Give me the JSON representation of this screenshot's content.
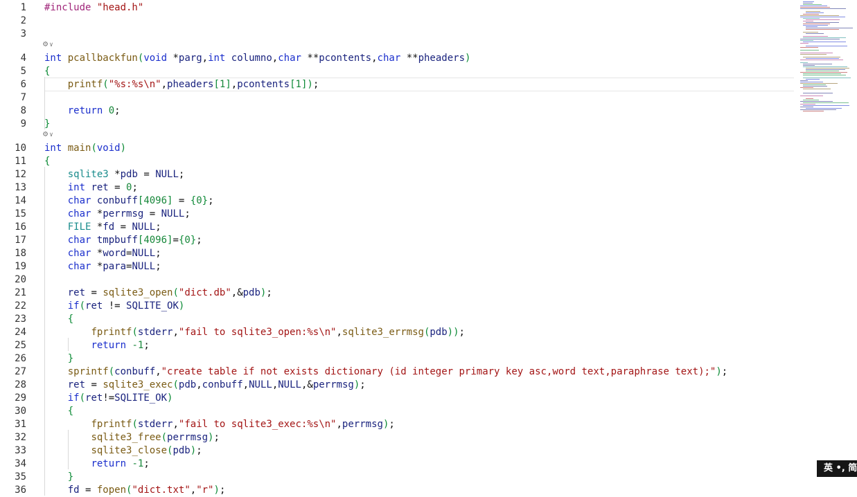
{
  "editor": {
    "current_line": 6,
    "lines": [
      {
        "n": "1",
        "t": [
          [
            "pp",
            "#include "
          ],
          [
            "str",
            "\"head.h\""
          ]
        ]
      },
      {
        "n": "2",
        "t": []
      },
      {
        "n": "3",
        "t": []
      },
      {
        "n": "4",
        "fold": true,
        "t": [
          [
            "kw",
            "int "
          ],
          [
            "fn",
            "pcallbackfun"
          ],
          [
            "br",
            "("
          ],
          [
            "kw",
            "void "
          ],
          [
            "",
            "*"
          ],
          [
            "var",
            "parg"
          ],
          [
            "",
            ","
          ],
          [
            "kw",
            "int "
          ],
          [
            "var",
            "columno"
          ],
          [
            "",
            ","
          ],
          [
            "kw",
            "char "
          ],
          [
            "",
            "**"
          ],
          [
            "var",
            "pcontents"
          ],
          [
            "",
            ","
          ],
          [
            "kw",
            "char "
          ],
          [
            "",
            "**"
          ],
          [
            "var",
            "pheaders"
          ],
          [
            "br",
            ")"
          ]
        ]
      },
      {
        "n": "5",
        "t": [
          [
            "br",
            "{"
          ]
        ]
      },
      {
        "n": "6",
        "t": [
          [
            "",
            "    "
          ],
          [
            "fn",
            "printf"
          ],
          [
            "br",
            "("
          ],
          [
            "str",
            "\"%s:%s\\n\""
          ],
          [
            "",
            ","
          ],
          [
            "var",
            "pheaders"
          ],
          [
            "br",
            "["
          ],
          [
            "num",
            "1"
          ],
          [
            "br",
            "]"
          ],
          [
            "",
            ","
          ],
          [
            "var",
            "pcontents"
          ],
          [
            "br",
            "["
          ],
          [
            "num",
            "1"
          ],
          [
            "br",
            "])"
          ],
          [
            "",
            ";"
          ]
        ]
      },
      {
        "n": "7",
        "t": []
      },
      {
        "n": "8",
        "t": [
          [
            "",
            "    "
          ],
          [
            "kw",
            "return "
          ],
          [
            "num",
            "0"
          ],
          [
            "",
            ";"
          ]
        ]
      },
      {
        "n": "9",
        "t": [
          [
            "br",
            "}"
          ]
        ]
      },
      {
        "n": "10",
        "fold": true,
        "t": [
          [
            "kw",
            "int "
          ],
          [
            "fn",
            "main"
          ],
          [
            "br",
            "("
          ],
          [
            "kw",
            "void"
          ],
          [
            "br",
            ")"
          ]
        ]
      },
      {
        "n": "11",
        "t": [
          [
            "br",
            "{"
          ]
        ]
      },
      {
        "n": "12",
        "t": [
          [
            "",
            "    "
          ],
          [
            "ty",
            "sqlite3 "
          ],
          [
            "",
            "*"
          ],
          [
            "var",
            "pdb"
          ],
          [
            "",
            " = "
          ],
          [
            "mac",
            "NULL"
          ],
          [
            "",
            ";"
          ]
        ]
      },
      {
        "n": "13",
        "t": [
          [
            "",
            "    "
          ],
          [
            "kw",
            "int "
          ],
          [
            "var",
            "ret"
          ],
          [
            "",
            " = "
          ],
          [
            "num",
            "0"
          ],
          [
            "",
            ";"
          ]
        ]
      },
      {
        "n": "14",
        "t": [
          [
            "",
            "    "
          ],
          [
            "kw",
            "char "
          ],
          [
            "var",
            "conbuff"
          ],
          [
            "br",
            "["
          ],
          [
            "num",
            "4096"
          ],
          [
            "br",
            "]"
          ],
          [
            "",
            " = "
          ],
          [
            "br",
            "{"
          ],
          [
            "num",
            "0"
          ],
          [
            "br",
            "}"
          ],
          [
            "",
            ";"
          ]
        ]
      },
      {
        "n": "15",
        "t": [
          [
            "",
            "    "
          ],
          [
            "kw",
            "char "
          ],
          [
            "",
            "*"
          ],
          [
            "var",
            "perrmsg"
          ],
          [
            "",
            " = "
          ],
          [
            "mac",
            "NULL"
          ],
          [
            "",
            ";"
          ]
        ]
      },
      {
        "n": "16",
        "t": [
          [
            "",
            "    "
          ],
          [
            "ty",
            "FILE "
          ],
          [
            "",
            "*"
          ],
          [
            "var",
            "fd"
          ],
          [
            "",
            " = "
          ],
          [
            "mac",
            "NULL"
          ],
          [
            "",
            ";"
          ]
        ]
      },
      {
        "n": "17",
        "t": [
          [
            "",
            "    "
          ],
          [
            "kw",
            "char "
          ],
          [
            "var",
            "tmpbuff"
          ],
          [
            "br",
            "["
          ],
          [
            "num",
            "4096"
          ],
          [
            "br",
            "]"
          ],
          [
            "",
            "="
          ],
          [
            "br",
            "{"
          ],
          [
            "num",
            "0"
          ],
          [
            "br",
            "}"
          ],
          [
            "",
            ";"
          ]
        ]
      },
      {
        "n": "18",
        "t": [
          [
            "",
            "    "
          ],
          [
            "kw",
            "char "
          ],
          [
            "",
            "*"
          ],
          [
            "var",
            "word"
          ],
          [
            "",
            "="
          ],
          [
            "mac",
            "NULL"
          ],
          [
            "",
            ";"
          ]
        ]
      },
      {
        "n": "19",
        "t": [
          [
            "",
            "    "
          ],
          [
            "kw",
            "char "
          ],
          [
            "",
            "*"
          ],
          [
            "var",
            "para"
          ],
          [
            "",
            "="
          ],
          [
            "mac",
            "NULL"
          ],
          [
            "",
            ";"
          ]
        ]
      },
      {
        "n": "20",
        "t": []
      },
      {
        "n": "21",
        "t": [
          [
            "",
            "    "
          ],
          [
            "var",
            "ret"
          ],
          [
            "",
            " = "
          ],
          [
            "fn",
            "sqlite3_open"
          ],
          [
            "br",
            "("
          ],
          [
            "str",
            "\"dict.db\""
          ],
          [
            "",
            ",&"
          ],
          [
            "var",
            "pdb"
          ],
          [
            "br",
            ")"
          ],
          [
            "",
            ";"
          ]
        ]
      },
      {
        "n": "22",
        "t": [
          [
            "",
            "    "
          ],
          [
            "kw",
            "if"
          ],
          [
            "br",
            "("
          ],
          [
            "var",
            "ret"
          ],
          [
            "",
            " != "
          ],
          [
            "mac",
            "SQLITE_OK"
          ],
          [
            "br",
            ")"
          ]
        ]
      },
      {
        "n": "23",
        "t": [
          [
            "",
            "    "
          ],
          [
            "br",
            "{"
          ]
        ]
      },
      {
        "n": "24",
        "t": [
          [
            "",
            "        "
          ],
          [
            "fn",
            "fprintf"
          ],
          [
            "br",
            "("
          ],
          [
            "var",
            "stderr"
          ],
          [
            "",
            ","
          ],
          [
            "str",
            "\"fail to sqlite3_open:%s\\n\""
          ],
          [
            "",
            ","
          ],
          [
            "fn",
            "sqlite3_errmsg"
          ],
          [
            "br",
            "("
          ],
          [
            "var",
            "pdb"
          ],
          [
            "br",
            "))"
          ],
          [
            "",
            ";"
          ]
        ]
      },
      {
        "n": "25",
        "t": [
          [
            "",
            "        "
          ],
          [
            "kw",
            "return "
          ],
          [
            "num",
            "-1"
          ],
          [
            "",
            ";"
          ]
        ]
      },
      {
        "n": "26",
        "t": [
          [
            "",
            "    "
          ],
          [
            "br",
            "}"
          ]
        ]
      },
      {
        "n": "27",
        "t": [
          [
            "",
            "    "
          ],
          [
            "fn",
            "sprintf"
          ],
          [
            "br",
            "("
          ],
          [
            "var",
            "conbuff"
          ],
          [
            "",
            ","
          ],
          [
            "str",
            "\"create table if not exists dictionary (id integer primary key asc,word text,paraphrase text);\""
          ],
          [
            "br",
            ")"
          ],
          [
            "",
            ";"
          ]
        ]
      },
      {
        "n": "28",
        "t": [
          [
            "",
            "    "
          ],
          [
            "var",
            "ret"
          ],
          [
            "",
            " = "
          ],
          [
            "fn",
            "sqlite3_exec"
          ],
          [
            "br",
            "("
          ],
          [
            "var",
            "pdb"
          ],
          [
            "",
            ","
          ],
          [
            "var",
            "conbuff"
          ],
          [
            "",
            ","
          ],
          [
            "mac",
            "NULL"
          ],
          [
            "",
            ","
          ],
          [
            "mac",
            "NULL"
          ],
          [
            "",
            ",&"
          ],
          [
            "var",
            "perrmsg"
          ],
          [
            "br",
            ")"
          ],
          [
            "",
            ";"
          ]
        ]
      },
      {
        "n": "29",
        "t": [
          [
            "",
            "    "
          ],
          [
            "kw",
            "if"
          ],
          [
            "br",
            "("
          ],
          [
            "var",
            "ret"
          ],
          [
            "",
            "!="
          ],
          [
            "mac",
            "SQLITE_OK"
          ],
          [
            "br",
            ")"
          ]
        ]
      },
      {
        "n": "30",
        "t": [
          [
            "",
            "    "
          ],
          [
            "br",
            "{"
          ]
        ]
      },
      {
        "n": "31",
        "t": [
          [
            "",
            "        "
          ],
          [
            "fn",
            "fprintf"
          ],
          [
            "br",
            "("
          ],
          [
            "var",
            "stderr"
          ],
          [
            "",
            ","
          ],
          [
            "str",
            "\"fail to sqlite3_exec:%s\\n\""
          ],
          [
            "",
            ","
          ],
          [
            "var",
            "perrmsg"
          ],
          [
            "br",
            ")"
          ],
          [
            "",
            ";"
          ]
        ]
      },
      {
        "n": "32",
        "t": [
          [
            "",
            "        "
          ],
          [
            "fn",
            "sqlite3_free"
          ],
          [
            "br",
            "("
          ],
          [
            "var",
            "perrmsg"
          ],
          [
            "br",
            ")"
          ],
          [
            "",
            ";"
          ]
        ]
      },
      {
        "n": "33",
        "t": [
          [
            "",
            "        "
          ],
          [
            "fn",
            "sqlite3_close"
          ],
          [
            "br",
            "("
          ],
          [
            "var",
            "pdb"
          ],
          [
            "br",
            ")"
          ],
          [
            "",
            ";"
          ]
        ]
      },
      {
        "n": "34",
        "t": [
          [
            "",
            "        "
          ],
          [
            "kw",
            "return "
          ],
          [
            "num",
            "-1"
          ],
          [
            "",
            ";"
          ]
        ]
      },
      {
        "n": "35",
        "t": [
          [
            "",
            "    "
          ],
          [
            "br",
            "}"
          ]
        ]
      },
      {
        "n": "36",
        "t": [
          [
            "",
            "    "
          ],
          [
            "var",
            "fd"
          ],
          [
            "",
            " = "
          ],
          [
            "fn",
            "fopen"
          ],
          [
            "br",
            "("
          ],
          [
            "str",
            "\"dict.txt\""
          ],
          [
            "",
            ","
          ],
          [
            "str",
            "\"r\""
          ],
          [
            "br",
            ")"
          ],
          [
            "",
            ";"
          ]
        ]
      }
    ]
  },
  "ime_indicator": {
    "label": "英 •, 简"
  },
  "colors": {
    "keyword": "#1a2ecc",
    "type": "#198c8c",
    "function": "#7a5b14",
    "string": "#a31515",
    "number": "#17873a",
    "variable": "#1a237e",
    "bracket": "#0b8a35",
    "preprocessor": "#a0267a"
  }
}
